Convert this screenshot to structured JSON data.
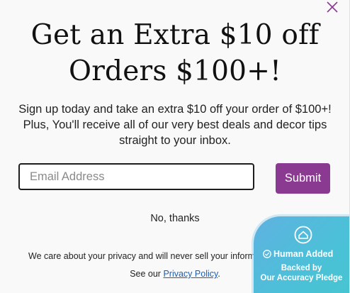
{
  "popup": {
    "close_icon": "close-x-icon",
    "headline_line1": "Get an Extra $10 off",
    "headline_line2": "Orders $100+!",
    "subtext": "Sign up today and take an extra $10 off your order of $100+! Plus, You'll receive all of our very best deals and decor tips straight to your inbox.",
    "email_placeholder": "Email Address",
    "email_value": "",
    "submit_label": "Submit",
    "no_thanks_label": "No, thanks",
    "privacy_text": "We care about your privacy and will never sell your information.",
    "policy_prefix": "See our ",
    "policy_link": "Privacy Policy",
    "policy_suffix": ".",
    "accent_color": "#8b3a92",
    "link_color": "#1a5fb4"
  },
  "badge": {
    "icon": "house-shield-icon",
    "check_icon": "check-circle-icon",
    "title": "Human Added",
    "subtitle_line1": "Backed by",
    "subtitle_line2": "Our Accuracy Pledge",
    "gradient_start": "#5fb2e0",
    "gradient_end": "#45c6cf"
  }
}
